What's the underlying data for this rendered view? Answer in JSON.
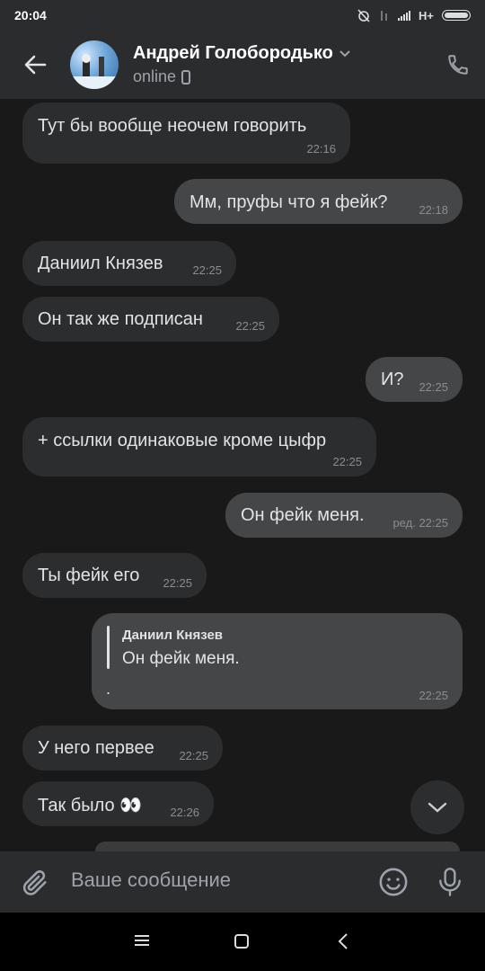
{
  "status_bar": {
    "time": "20:04",
    "network": "H+"
  },
  "header": {
    "contact_name": "Андрей Голобородько",
    "presence": "online"
  },
  "messages": [
    {
      "direction": "in",
      "text": "Тут бы вообще неочем говорить",
      "time": "22:16"
    },
    {
      "direction": "out",
      "text": "Мм, пруфы что я фейк?",
      "time": "22:18"
    },
    {
      "direction": "in",
      "text": "Даниил Князев",
      "time": "22:25"
    },
    {
      "direction": "in",
      "text": "Он так же подписан",
      "time": "22:25"
    },
    {
      "direction": "out",
      "text": "И?",
      "time": "22:25"
    },
    {
      "direction": "in",
      "text": "+ ссылки одинаковые кроме цыфр",
      "time": "22:25"
    },
    {
      "direction": "out",
      "text": "Он фейк меня.",
      "time": "22:25",
      "edited_label": "ред."
    },
    {
      "direction": "in",
      "text": "Ты фейк его",
      "time": "22:25"
    },
    {
      "direction": "out",
      "reply_author": "Даниил Князев",
      "reply_text": "Он фейк меня.",
      "text": ".",
      "time": "22:25"
    },
    {
      "direction": "in",
      "text": "У него первее",
      "time": "22:25"
    },
    {
      "direction": "in",
      "text": "Так было 👀",
      "time": "22:26"
    }
  ],
  "composer": {
    "placeholder": "Ваше сообщение"
  },
  "icons": {
    "back": "arrow-left-icon",
    "call": "phone-icon",
    "attach": "paperclip-icon",
    "emoji": "smile-icon",
    "mic": "microphone-icon",
    "scroll": "chevron-down-icon"
  }
}
